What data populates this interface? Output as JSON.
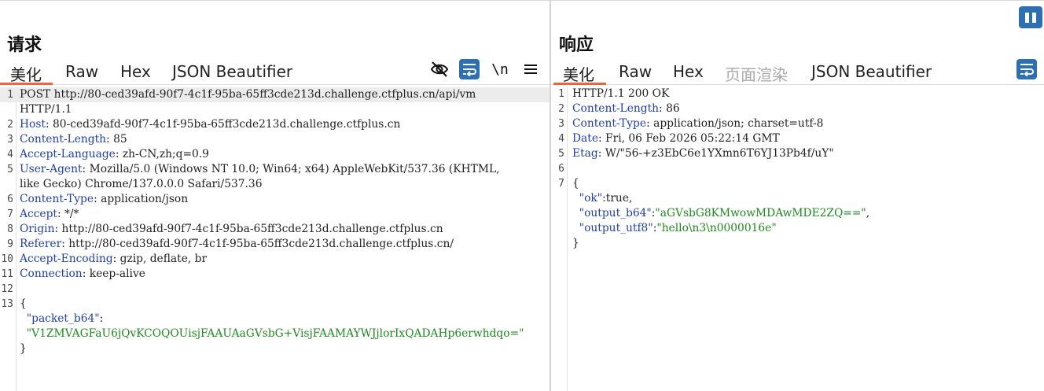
{
  "request": {
    "title": "请求",
    "tabs": [
      "美化",
      "Raw",
      "Hex",
      "JSON Beautifier"
    ],
    "icons": [
      "eye-off-icon",
      "wrap-icon",
      "newline-icon",
      "menu-icon"
    ],
    "newline_label": "\\n",
    "lines": [
      {
        "n": "1",
        "t": "POST http://80-ced39afd-90f7-4c1f-95ba-65ff3cde213d.challenge.ctfplus.cn/api/vm"
      },
      {
        "n": "",
        "t": "HTTP/1.1"
      },
      {
        "n": "2",
        "k": "Host",
        "v": ": 80-ced39afd-90f7-4c1f-95ba-65ff3cde213d.challenge.ctfplus.cn"
      },
      {
        "n": "3",
        "k": "Content-Length",
        "v": ": 85"
      },
      {
        "n": "4",
        "k": "Accept-Language",
        "v": ": zh-CN,zh;q=0.9"
      },
      {
        "n": "5",
        "k": "User-Agent",
        "v": ": Mozilla/5.0 (Windows NT 10.0; Win64; x64) AppleWebKit/537.36 (KHTML,"
      },
      {
        "n": "",
        "t": "like Gecko) Chrome/137.0.0.0 Safari/537.36"
      },
      {
        "n": "6",
        "k": "Content-Type",
        "v": ": application/json"
      },
      {
        "n": "7",
        "k": "Accept",
        "v": ": */*"
      },
      {
        "n": "8",
        "k": "Origin",
        "v": ": http://80-ced39afd-90f7-4c1f-95ba-65ff3cde213d.challenge.ctfplus.cn"
      },
      {
        "n": "9",
        "k": "Referer",
        "v": ": http://80-ced39afd-90f7-4c1f-95ba-65ff3cde213d.challenge.ctfplus.cn/"
      },
      {
        "n": "10",
        "k": "Accept-Encoding",
        "v": ": gzip, deflate, br"
      },
      {
        "n": "11",
        "k": "Connection",
        "v": ": keep-alive"
      },
      {
        "n": "12",
        "t": ""
      },
      {
        "n": "13",
        "t": "{"
      },
      {
        "n": "",
        "jk": "  \"packet_b64\"",
        "v": ":"
      },
      {
        "n": "",
        "js": "  \"V1ZMVAGFaU6jQvKCOQOUisjFAAUAaGVsbG+VisjFAAMAYWJjlorIxQADAHp6erwhdqo=\""
      },
      {
        "n": "",
        "t": "}"
      }
    ]
  },
  "response": {
    "title": "响应",
    "tabs": [
      "美化",
      "Raw",
      "Hex",
      "页面渲染",
      "JSON Beautifier"
    ],
    "icons": [
      "wrap-icon"
    ],
    "lines": [
      {
        "n": "1",
        "t": "HTTP/1.1 200 OK"
      },
      {
        "n": "2",
        "k": "Content-Length",
        "v": ": 86"
      },
      {
        "n": "3",
        "k": "Content-Type",
        "v": ": application/json; charset=utf-8"
      },
      {
        "n": "4",
        "k": "Date",
        "v": ": Fri, 06 Feb 2026 05:22:14 GMT"
      },
      {
        "n": "5",
        "k": "Etag",
        "v": ": W/\"56-+z3EbC6e1YXmn6T6YJ13Pb4f/uY\""
      },
      {
        "n": "6",
        "t": ""
      },
      {
        "n": "7",
        "t": "{"
      },
      {
        "n": "",
        "jk": "  \"ok\"",
        "v": ":true,"
      },
      {
        "n": "",
        "jk": "  \"output_b64\"",
        "v": ":",
        "js": "\"aGVsbG8KMwowMDAwMDE2ZQ==\"",
        "tail": ","
      },
      {
        "n": "",
        "jk": "  \"output_utf8\"",
        "v": ":",
        "js": "\"hello\\n3\\n0000016e\""
      },
      {
        "n": "",
        "t": "}"
      }
    ]
  },
  "colors": {
    "accent": "#2e6fb3",
    "tab_underline": "#f0643c",
    "key": "#2140a8",
    "string": "#1e8a1e"
  }
}
